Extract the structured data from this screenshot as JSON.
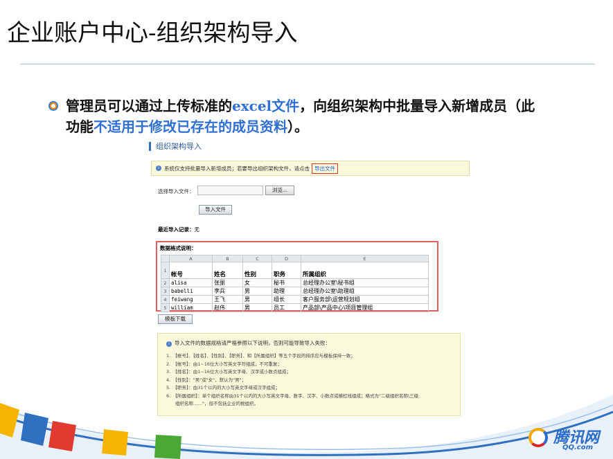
{
  "slide": {
    "title": "企业账户中心-组织架构导入",
    "bullet_part1": "管理员可以通过上传标准的",
    "bullet_hl1": "excel文件",
    "bullet_part2": "，向组织架构中批量导入新增成员（此功能",
    "bullet_hl2": "不适用于修改已存在的成员资料",
    "bullet_part3": "）。"
  },
  "screenshot": {
    "title": "组织架构导入",
    "notice_text": "系统仅支持批量导入新增成员；若要导出组织架构文件，请点击",
    "export_link": "导出文件",
    "file_label": "选择导入文件：",
    "browse_label": "浏览...",
    "import_label": "导入文件",
    "recent_label": "最近导入记录：",
    "recent_value": "无",
    "format_title": "数据格式说明：",
    "sheet": {
      "columns": [
        "A",
        "B",
        "C",
        "D",
        "E"
      ],
      "headers": [
        "帐号",
        "姓名",
        "性别",
        "职务",
        "所属组织"
      ],
      "rows": [
        [
          "alisa",
          "张丽",
          "女",
          "秘书",
          "总经理办公室\\秘书组"
        ],
        [
          "babelli",
          "李兵",
          "男",
          "助理",
          "总经理办公室\\助理组"
        ],
        [
          "feiwang",
          "王飞",
          "男",
          "组长",
          "客户服务部\\运营规划组"
        ],
        [
          "william",
          "赵伟",
          "男",
          "员工",
          "产品部\\产品中心\\项目管理组"
        ]
      ],
      "row_numbers": [
        "1",
        "2",
        "3",
        "4",
        "5"
      ]
    },
    "template_label": "模板下载",
    "notes_head": "导入文件的数据规格请严格参照以下说明，否则可能导致导入失败：",
    "notes": [
      "1.　【帐号】、【姓名】、【性别】、【职务】、和【所属组织】等五个字段的排序应与模板保持一致；",
      "2.　【帐号】：由1~16位大小写英文字符组成，不可重复；",
      "3.　【姓名】：由1~16位大小写英文字母、汉字或小数点组成；",
      "4.　【性别】：\"男\"或\"女\"，默认为\"男\"；",
      "5.　【职务】：由31个以内的大小写英文字母或汉字组成；",
      "6.　【所属组织】：单个组织名称由31个以内的大小写英文字母、数字、汉字、小数点或横杠线组成；格式为\"二级组织名称\\三级",
      "　　组织名称……\"，但不包括企业的根组织。"
    ]
  },
  "logo": {
    "text": "腾讯网",
    "sub": "QQ.com"
  },
  "colors": {
    "highlight": "#2f6fd1",
    "alert_border": "#e06060",
    "notice_bg": "#fbf9dc"
  }
}
